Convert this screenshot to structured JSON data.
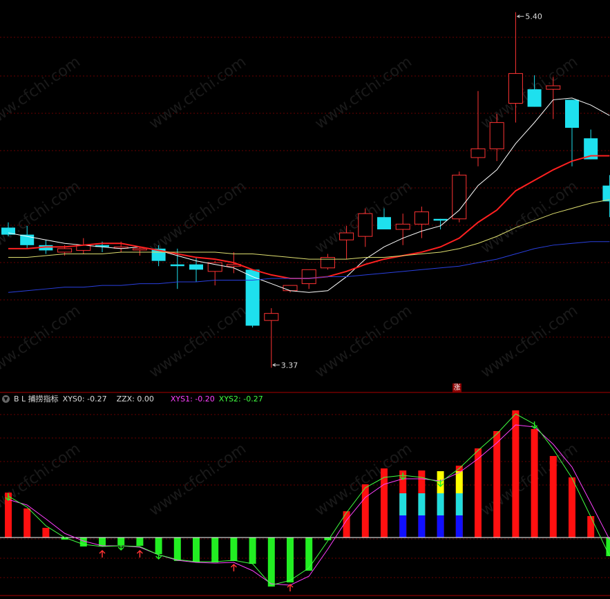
{
  "chart_data": [
    {
      "type": "candlestick",
      "annotations": {
        "high_label": "5.40",
        "low_label": "3.37"
      },
      "y_range": [
        3.3,
        5.45
      ],
      "candles": [
        {
          "o": 4.17,
          "h": 4.2,
          "l": 4.12,
          "c": 4.13
        },
        {
          "o": 4.13,
          "h": 4.18,
          "l": 4.05,
          "c": 4.07
        },
        {
          "o": 4.07,
          "h": 4.1,
          "l": 4.02,
          "c": 4.04
        },
        {
          "o": 4.03,
          "h": 4.07,
          "l": 4.01,
          "c": 4.05
        },
        {
          "o": 4.04,
          "h": 4.11,
          "l": 4.02,
          "c": 4.07
        },
        {
          "o": 4.07,
          "h": 4.09,
          "l": 4.03,
          "c": 4.06
        },
        {
          "o": 4.06,
          "h": 4.09,
          "l": 4.03,
          "c": 4.06
        },
        {
          "o": 4.05,
          "h": 4.06,
          "l": 4.01,
          "c": 4.05
        },
        {
          "o": 4.05,
          "h": 4.07,
          "l": 3.95,
          "c": 3.98
        },
        {
          "o": 3.96,
          "h": 4.05,
          "l": 3.82,
          "c": 3.95
        },
        {
          "o": 3.96,
          "h": 4.0,
          "l": 3.86,
          "c": 3.93
        },
        {
          "o": 3.92,
          "h": 3.98,
          "l": 3.84,
          "c": 3.97
        },
        {
          "o": 3.95,
          "h": 4.03,
          "l": 3.91,
          "c": 3.96
        },
        {
          "o": 3.93,
          "h": 3.93,
          "l": 3.6,
          "c": 3.61
        },
        {
          "o": 3.64,
          "h": 3.71,
          "l": 3.37,
          "c": 3.68
        },
        {
          "o": 3.81,
          "h": 3.84,
          "l": 3.8,
          "c": 3.84
        },
        {
          "o": 3.85,
          "h": 3.93,
          "l": 3.82,
          "c": 3.93
        },
        {
          "o": 3.94,
          "h": 4.02,
          "l": 3.93,
          "c": 4.0
        },
        {
          "o": 4.1,
          "h": 4.18,
          "l": 3.99,
          "c": 4.14
        },
        {
          "o": 4.12,
          "h": 4.28,
          "l": 4.06,
          "c": 4.25
        },
        {
          "o": 4.23,
          "h": 4.28,
          "l": 4.17,
          "c": 4.16
        },
        {
          "o": 4.16,
          "h": 4.25,
          "l": 4.07,
          "c": 4.19
        },
        {
          "o": 4.19,
          "h": 4.29,
          "l": 4.11,
          "c": 4.26
        },
        {
          "o": 4.22,
          "h": 4.22,
          "l": 4.16,
          "c": 4.21
        },
        {
          "o": 4.22,
          "h": 4.49,
          "l": 4.2,
          "c": 4.47
        },
        {
          "o": 4.57,
          "h": 4.95,
          "l": 4.52,
          "c": 4.62
        },
        {
          "o": 4.62,
          "h": 4.82,
          "l": 4.55,
          "c": 4.77
        },
        {
          "o": 4.88,
          "h": 5.4,
          "l": 4.77,
          "c": 5.05
        },
        {
          "o": 4.96,
          "h": 5.04,
          "l": 4.86,
          "c": 4.86
        },
        {
          "o": 4.96,
          "h": 5.03,
          "l": 4.79,
          "c": 4.98
        },
        {
          "o": 4.9,
          "h": 4.9,
          "l": 4.52,
          "c": 4.74
        },
        {
          "o": 4.68,
          "h": 4.73,
          "l": 4.56,
          "c": 4.56
        },
        {
          "o": 4.41,
          "h": 4.47,
          "l": 4.23,
          "c": 4.32
        }
      ],
      "series": [
        {
          "name": "white",
          "color": "#ffffff",
          "values": [
            4.14,
            4.12,
            4.1,
            4.08,
            4.07,
            4.06,
            4.05,
            4.06,
            4.04,
            4.01,
            3.98,
            3.96,
            3.94,
            3.89,
            3.85,
            3.81,
            3.8,
            3.81,
            3.89,
            3.99,
            4.06,
            4.11,
            4.15,
            4.18,
            4.27,
            4.41,
            4.5,
            4.65,
            4.77,
            4.9,
            4.91,
            4.87,
            4.81
          ]
        },
        {
          "name": "red",
          "color": "#ff2020",
          "values": [
            4.05,
            4.05,
            4.06,
            4.06,
            4.07,
            4.08,
            4.08,
            4.06,
            4.04,
            4.02,
            4.0,
            3.99,
            3.97,
            3.93,
            3.9,
            3.88,
            3.88,
            3.89,
            3.92,
            3.96,
            3.99,
            4.01,
            4.03,
            4.06,
            4.11,
            4.2,
            4.27,
            4.38,
            4.44,
            4.5,
            4.55,
            4.58,
            4.58
          ]
        },
        {
          "name": "yellow",
          "color": "#e0e070",
          "values": [
            4.0,
            4.0,
            4.01,
            4.02,
            4.02,
            4.02,
            4.03,
            4.03,
            4.03,
            4.03,
            4.03,
            4.03,
            4.02,
            4.02,
            4.01,
            4.0,
            3.99,
            3.99,
            3.99,
            4.0,
            4.0,
            4.01,
            4.02,
            4.03,
            4.05,
            4.08,
            4.12,
            4.17,
            4.21,
            4.25,
            4.28,
            4.31,
            4.33
          ]
        },
        {
          "name": "blue",
          "color": "#2a40e0",
          "values": [
            3.8,
            3.81,
            3.82,
            3.83,
            3.83,
            3.84,
            3.84,
            3.85,
            3.85,
            3.86,
            3.86,
            3.87,
            3.87,
            3.87,
            3.88,
            3.88,
            3.88,
            3.89,
            3.89,
            3.9,
            3.91,
            3.92,
            3.93,
            3.94,
            3.95,
            3.97,
            3.99,
            4.02,
            4.05,
            4.07,
            4.08,
            4.09,
            4.09
          ]
        }
      ]
    },
    {
      "type": "bar",
      "y_range": [
        -0.8,
        1.9
      ],
      "bars": [
        0.65,
        0.42,
        0.14,
        -0.03,
        -0.13,
        -0.13,
        -0.11,
        -0.12,
        -0.24,
        -0.34,
        -0.36,
        -0.36,
        -0.34,
        -0.38,
        -0.71,
        -0.65,
        -0.48,
        -0.04,
        0.38,
        0.77,
        1.0,
        0.97,
        0.97,
        0.73,
        1.04,
        1.29,
        1.54,
        1.84,
        1.57,
        1.18,
        0.87,
        0.31,
        -0.27
      ],
      "bar_stacks": {
        "21": {
          "blue": 0.32,
          "cyan": 0.32
        },
        "22": {
          "blue": 0.32,
          "cyan": 0.32
        },
        "23": {
          "blue": 0.32,
          "cyan": 0.32,
          "yellow": 0.32
        },
        "24": {
          "blue": 0.32,
          "cyan": 0.32,
          "yellow": 0.32
        }
      },
      "signals": [
        {
          "idx": 0,
          "type": "down"
        },
        {
          "idx": 5,
          "type": "up"
        },
        {
          "idx": 6,
          "type": "down"
        },
        {
          "idx": 7,
          "type": "up"
        },
        {
          "idx": 8,
          "type": "down"
        },
        {
          "idx": 12,
          "type": "up"
        },
        {
          "idx": 15,
          "type": "up"
        },
        {
          "idx": 21,
          "type": "down"
        },
        {
          "idx": 23,
          "type": "down"
        },
        {
          "idx": 28,
          "type": "down"
        }
      ],
      "series": [
        {
          "name": "XYS1",
          "color": "#ff40ff",
          "values": [
            0.55,
            0.47,
            0.27,
            0.06,
            -0.05,
            -0.12,
            -0.12,
            -0.14,
            -0.25,
            -0.33,
            -0.36,
            -0.37,
            -0.36,
            -0.48,
            -0.67,
            -0.69,
            -0.56,
            -0.17,
            0.25,
            0.58,
            0.77,
            0.85,
            0.85,
            0.82,
            0.94,
            1.14,
            1.37,
            1.63,
            1.6,
            1.35,
            1.02,
            0.5,
            -0.03
          ]
        },
        {
          "name": "XYS2",
          "color": "#40ff40",
          "values": [
            0.6,
            0.44,
            0.17,
            0.0,
            -0.1,
            -0.13,
            -0.12,
            -0.13,
            -0.25,
            -0.32,
            -0.35,
            -0.35,
            -0.33,
            -0.38,
            -0.69,
            -0.62,
            -0.44,
            -0.05,
            0.36,
            0.72,
            0.87,
            0.9,
            0.87,
            0.8,
            1.0,
            1.26,
            1.5,
            1.79,
            1.64,
            1.28,
            0.86,
            0.3,
            -0.27
          ]
        }
      ]
    }
  ],
  "header": {
    "indicator_name": "B L 捕捞指标",
    "xys0": "XYS0: -0.27",
    "zzx": "ZZX: 0.00",
    "xys1": "XYS1: -0.20",
    "xys2": "XYS2: -0.27"
  },
  "badge": "涨",
  "watermark": "www.cfchi.com",
  "colors": {
    "up": "#ff3333",
    "down": "#1ee0ee",
    "grid": "#6a0000",
    "macd_up": "#ff1010",
    "macd_down": "#22ee22",
    "header_magenta": "#ff40ff",
    "header_green": "#40ff40"
  }
}
